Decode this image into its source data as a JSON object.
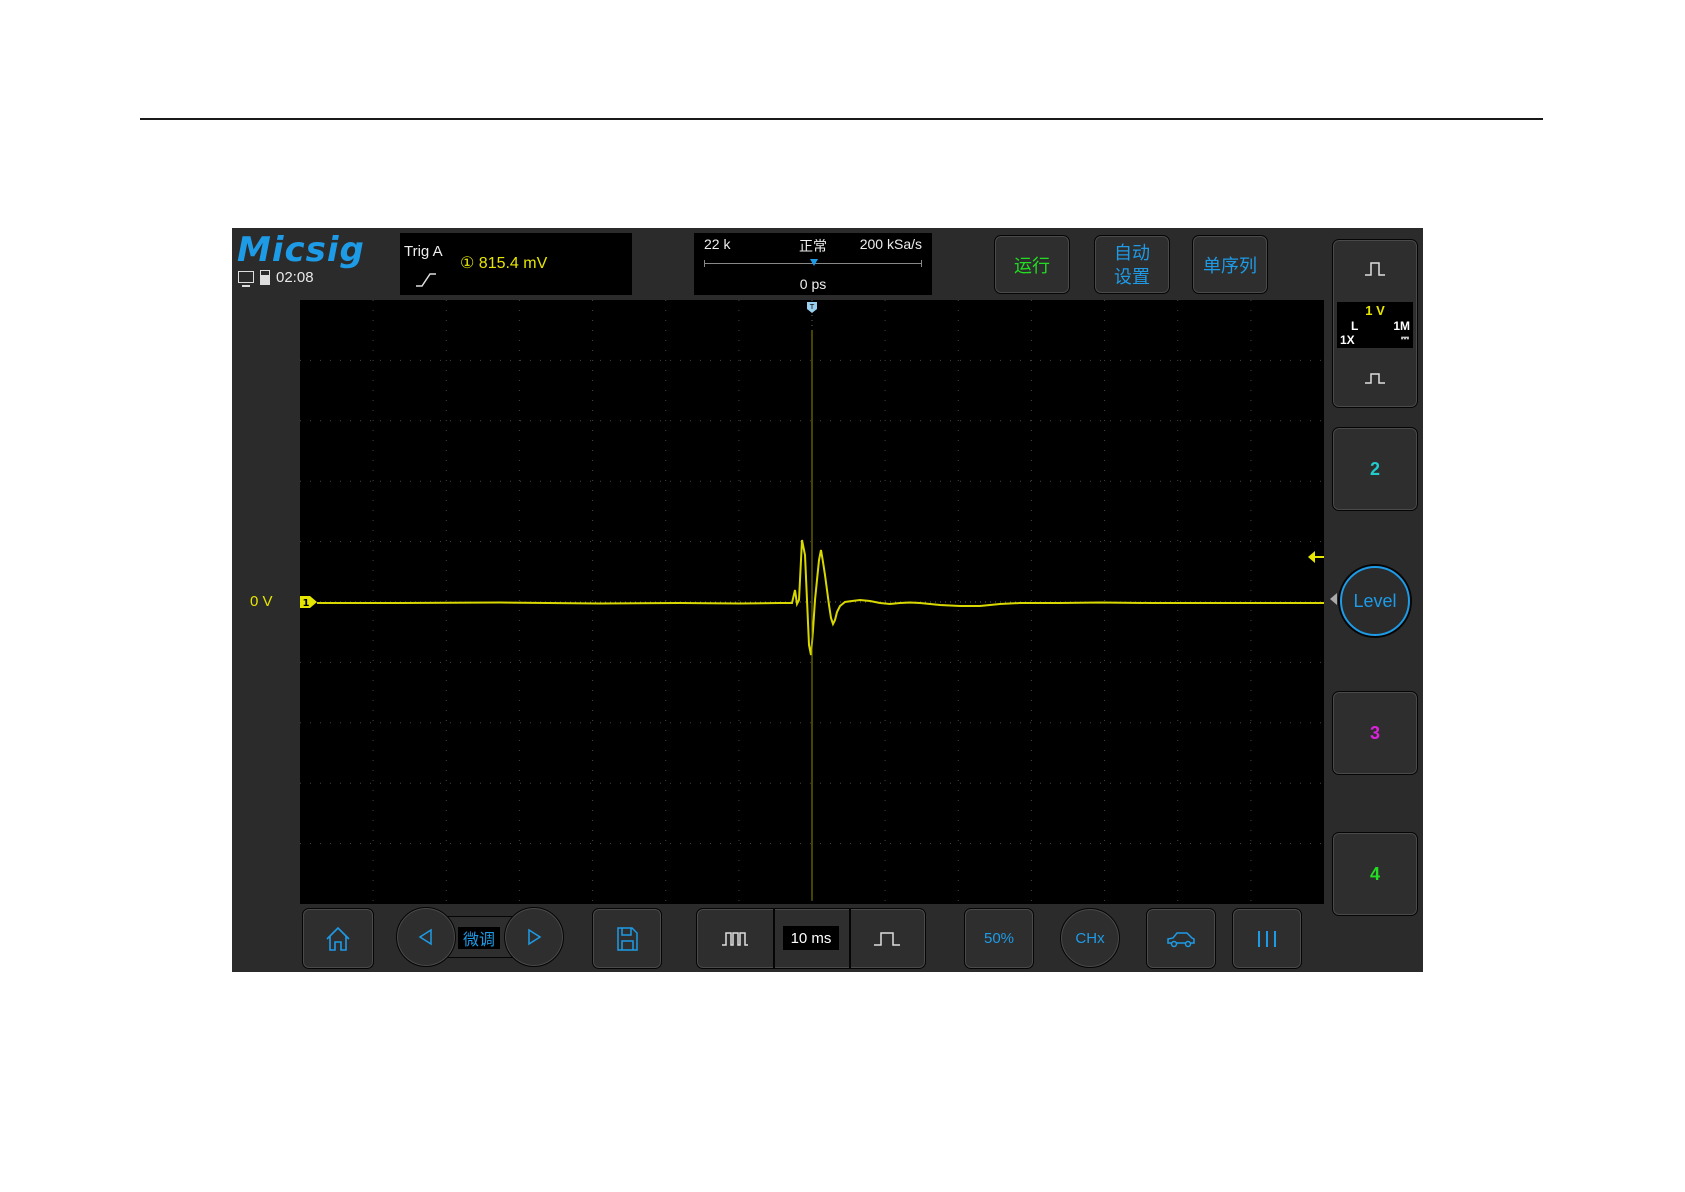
{
  "app": {
    "logo": "Micsig",
    "time": "02:08",
    "icons": [
      "monitor-icon",
      "battery-icon"
    ]
  },
  "trigger": {
    "label": "Trig  A",
    "source_value": "① 815.4  mV",
    "edge_icon": "rising-edge-icon"
  },
  "horizontal": {
    "memory_depth": "22 k",
    "acq_mode": "正常",
    "sample_rate": "200 kSa/s",
    "position": "0 ps"
  },
  "top_buttons": {
    "run": "运行",
    "auto_line1": "自动",
    "auto_line2": "设置",
    "single": "单序列"
  },
  "waveform": {
    "zero_label": "0  V",
    "ch1_marker": "1",
    "trigger_pos_marker": "T"
  },
  "channels": {
    "ch1_scale": "1 V",
    "ch1_coupling": "L",
    "ch1_impedance": "1M",
    "ch1_probe": "1X",
    "ch1_dc": "⎓",
    "ch2": "2",
    "ch3": "3",
    "ch4": "4",
    "level": "Level"
  },
  "bottom": {
    "fine": "微调",
    "timebase": "10 ms",
    "fifty_pct": "50%",
    "chx": "CHx"
  },
  "colors": {
    "accent": "#1e9be6",
    "ch1": "#e6e600",
    "ch2": "#22cccc",
    "ch3": "#dd22dd",
    "ch4": "#22dd22",
    "run": "#22dd22"
  }
}
